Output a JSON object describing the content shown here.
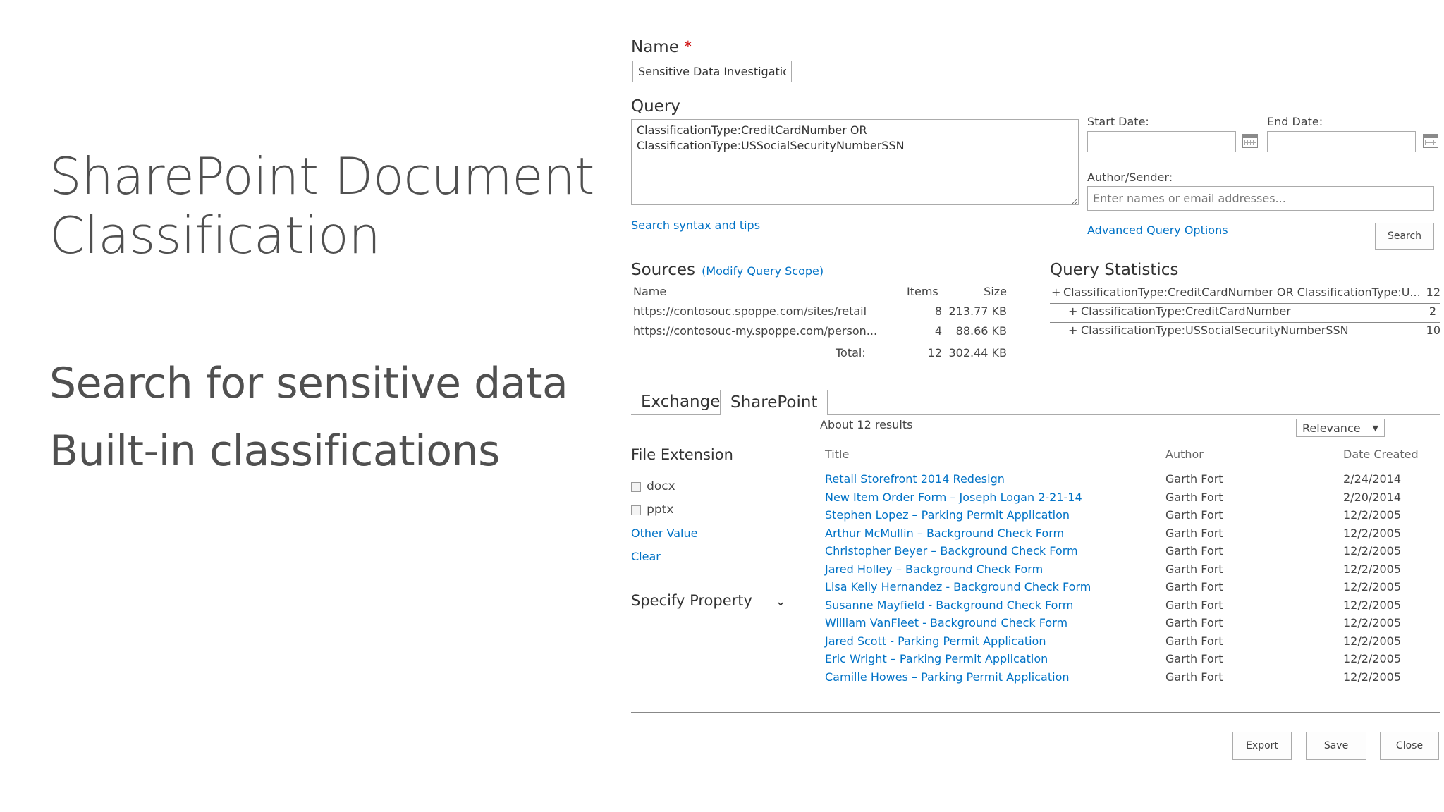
{
  "slide": {
    "title_line1": "SharePoint Document",
    "title_line2": "Classification",
    "bullet1": "Search for sensitive data",
    "bullet2": "Built-in classifications"
  },
  "form": {
    "name_label": "Name",
    "required_marker": "*",
    "name_value": "Sensitive Data Investigation",
    "query_label": "Query",
    "query_value": "ClassificationType:CreditCardNumber OR\nClassificationType:USSocialSecurityNumberSSN",
    "search_syntax_link": "Search syntax and tips",
    "start_date_label": "Start Date:",
    "end_date_label": "End Date:",
    "author_label": "Author/Sender:",
    "author_placeholder": "Enter names or email addresses...",
    "advanced_link": "Advanced Query Options",
    "search_button": "Search"
  },
  "sources": {
    "title": "Sources",
    "modify_link": "(Modify Query Scope)",
    "headers": {
      "name": "Name",
      "items": "Items",
      "size": "Size"
    },
    "rows": [
      {
        "name": "https://contosouc.spoppe.com/sites/retail",
        "items": "8",
        "size": "213.77 KB"
      },
      {
        "name": "https://contosouc-my.spoppe.com/person...",
        "items": "4",
        "size": "88.66 KB"
      }
    ],
    "total_label": "Total:",
    "total_items": "12",
    "total_size": "302.44 KB"
  },
  "stats": {
    "title": "Query Statistics",
    "rows": [
      {
        "toggle": "+",
        "label": "ClassificationType:CreditCardNumber OR ClassificationType:U...",
        "count": "12"
      },
      {
        "toggle": "+",
        "label": "ClassificationType:CreditCardNumber",
        "count": "2"
      },
      {
        "toggle": "+",
        "label": "ClassificationType:USSocialSecurityNumberSSN",
        "count": "10"
      }
    ]
  },
  "tabs": [
    {
      "label": "Exchange",
      "active": false
    },
    {
      "label": "SharePoint",
      "active": true
    }
  ],
  "results": {
    "count_text": "About 12 results",
    "sort_value": "Relevance",
    "headers": {
      "title": "Title",
      "author": "Author",
      "date": "Date Created"
    },
    "rows": [
      {
        "title": "Retail Storefront 2014 Redesign",
        "author": "Garth Fort",
        "date": "2/24/2014"
      },
      {
        "title": "New Item Order Form – Joseph Logan 2-21-14",
        "author": "Garth Fort",
        "date": "2/20/2014"
      },
      {
        "title": "Stephen Lopez – Parking Permit Application",
        "author": "Garth Fort",
        "date": "12/2/2005"
      },
      {
        "title": "Arthur McMullin – Background Check Form",
        "author": "Garth Fort",
        "date": "12/2/2005"
      },
      {
        "title": "Christopher Beyer – Background Check Form",
        "author": "Garth Fort",
        "date": "12/2/2005"
      },
      {
        "title": "Jared Holley – Background Check Form",
        "author": "Garth Fort",
        "date": "12/2/2005"
      },
      {
        "title": "Lisa Kelly Hernandez - Background Check Form",
        "author": "Garth Fort",
        "date": "12/2/2005"
      },
      {
        "title": "Susanne Mayfield - Background Check Form",
        "author": "Garth Fort",
        "date": "12/2/2005"
      },
      {
        "title": "William VanFleet - Background Check Form",
        "author": "Garth Fort",
        "date": "12/2/2005"
      },
      {
        "title": "Jared Scott - Parking Permit Application",
        "author": "Garth Fort",
        "date": "12/2/2005"
      },
      {
        "title": "Eric Wright – Parking Permit Application",
        "author": "Garth Fort",
        "date": "12/2/2005"
      },
      {
        "title": "Camille Howes – Parking Permit Application",
        "author": "Garth Fort",
        "date": "12/2/2005"
      }
    ]
  },
  "refiners": {
    "file_ext_title": "File Extension",
    "options": [
      "docx",
      "pptx"
    ],
    "other_value": "Other Value",
    "clear": "Clear",
    "specify_property": "Specify Property",
    "chevron": "⌄"
  },
  "footer": {
    "export": "Export",
    "save": "Save",
    "close": "Close"
  }
}
